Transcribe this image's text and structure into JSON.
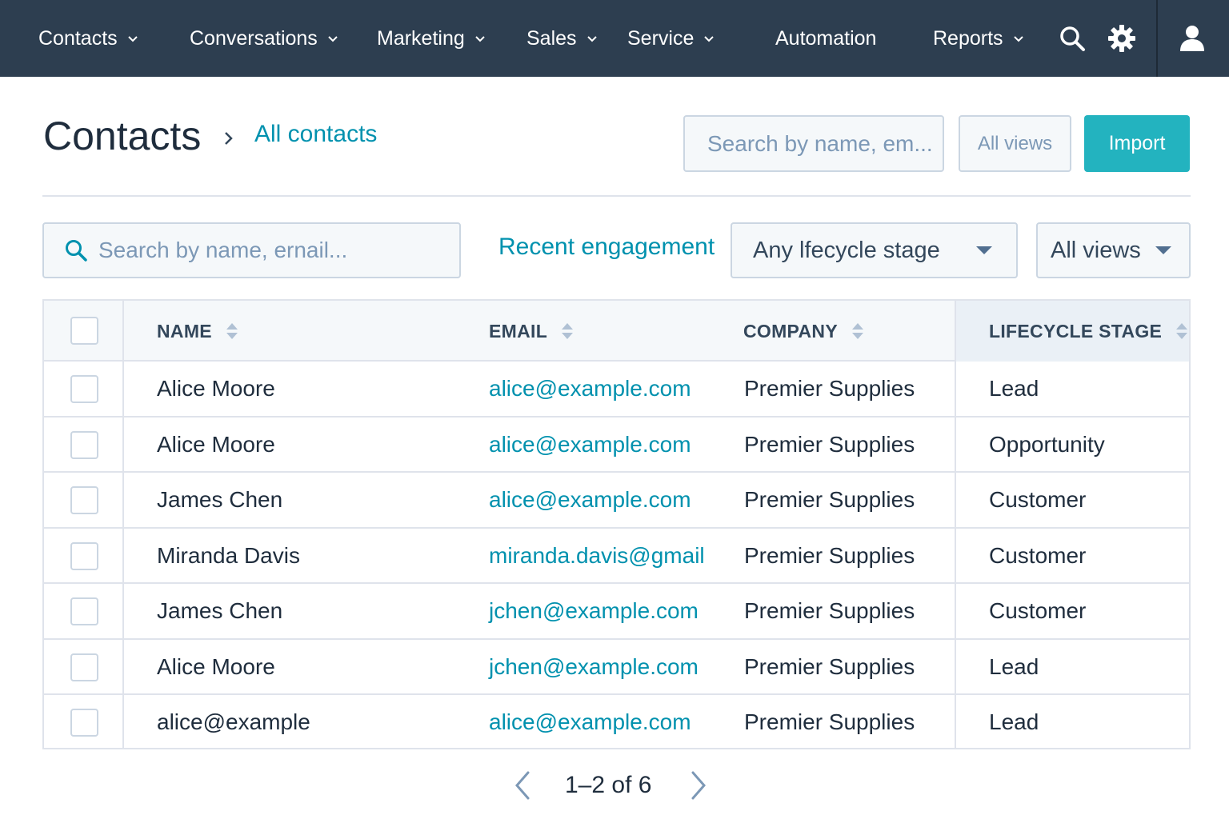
{
  "nav": {
    "items": [
      {
        "label": "Contacts",
        "has_chevron": true
      },
      {
        "label": "Conversations",
        "has_chevron": true
      },
      {
        "label": "Marketing",
        "has_chevron": true
      },
      {
        "label": "Sales",
        "has_chevron": true
      },
      {
        "label": "Service",
        "has_chevron": true
      },
      {
        "label": "Automation",
        "has_chevron": false
      },
      {
        "label": "Reports",
        "has_chevron": true
      }
    ],
    "icons": [
      "search-icon",
      "gear-icon",
      "user-icon"
    ],
    "background": "#2d3e50"
  },
  "header": {
    "title": "Contacts",
    "breadcrumb_link": "All contacts",
    "search_placeholder": "Search by name, em...",
    "views_button": "All views",
    "import_button": "Import",
    "accent": "#23b3bf"
  },
  "filters": {
    "search_placeholder": "Search by name, ernail...",
    "recent_link": "Recent engagement",
    "lifecycle_dropdown": "Any lfecycle stage",
    "views_dropdown": "All views"
  },
  "table": {
    "columns": [
      "NAME",
      "EMAIL",
      "COMPANY",
      "LIFECYCLE STAGE"
    ],
    "rows": [
      {
        "name": "Alice Moore",
        "email": "alice@example.com",
        "company": "Premier Supplies",
        "stage": "Lead"
      },
      {
        "name": "Alice Moore",
        "email": "alice@example.com",
        "company": "Premier Supplies",
        "stage": "Opportunity"
      },
      {
        "name": "James Chen",
        "email": "alice@example.com",
        "company": "Premier Supplies",
        "stage": "Customer"
      },
      {
        "name": "Miranda Davis",
        "email": "miranda.davis@gmail",
        "company": "Premier Supplies",
        "stage": "Customer"
      },
      {
        "name": "James Chen",
        "email": "jchen@example.com",
        "company": "Premier Supplies",
        "stage": "Customer"
      },
      {
        "name": "Alice Moore",
        "email": "jchen@example.com",
        "company": "Premier Supplies",
        "stage": "Lead"
      },
      {
        "name": "alice@example",
        "email": "alice@example.com",
        "company": "Premier Supplies",
        "stage": "Lead"
      }
    ]
  },
  "pagination": {
    "label": "1–2 of 6"
  }
}
